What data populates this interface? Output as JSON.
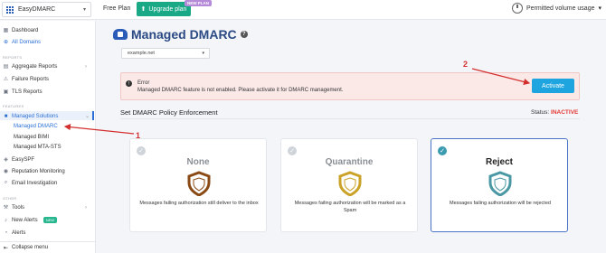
{
  "topbar": {
    "org_name": "EasyDMARC",
    "plan": "Free Plan",
    "upgrade_label": "Upgrade plan",
    "new_plan_badge": "NEW PLAN",
    "usage_label": "Permitted volume usage"
  },
  "sidebar": {
    "top_items": [
      {
        "label": "Dashboard",
        "icon": "dashboard-icon"
      },
      {
        "label": "All Domains",
        "icon": "globe-icon"
      }
    ],
    "reports_section": "REPORTS",
    "report_items": [
      {
        "label": "Aggregate Reports",
        "icon": "chart-icon"
      },
      {
        "label": "Failure Reports",
        "icon": "warning-icon"
      },
      {
        "label": "TLS Reports",
        "icon": "lock-icon"
      }
    ],
    "features_section": "FEATURES",
    "managed_solutions": "Managed Solutions",
    "sub_items": [
      {
        "label": "Managed DMARC"
      },
      {
        "label": "Managed BIMI"
      },
      {
        "label": "Managed MTA-STS"
      }
    ],
    "feature_items": [
      {
        "label": "EasySPF",
        "icon": "spf-icon"
      },
      {
        "label": "Reputation Monitoring",
        "icon": "monitor-icon"
      },
      {
        "label": "Email Investigation",
        "icon": "search-icon"
      }
    ],
    "other_section": "OTHER",
    "other_items": [
      {
        "label": "Tools",
        "icon": "tools-icon"
      },
      {
        "label": "New Alerts",
        "icon": "bell-icon",
        "badge": "NEW"
      },
      {
        "label": "Alerts",
        "icon": "alert-icon"
      }
    ],
    "collapse_label": "Collapse menu"
  },
  "main": {
    "title": "Managed DMARC",
    "domain": "example.net",
    "error_title": "Error",
    "error_message": "Managed DMARC feature is not enabled. Please activate it for DMARC management.",
    "activate_label": "Activate",
    "policy_heading": "Set DMARC Policy Enforcement",
    "status_label": "Status:",
    "status_value": "INACTIVE",
    "cards": [
      {
        "name": "None",
        "desc": "Messages failing authorization still deliver to the inbox",
        "color": "#8a4a16"
      },
      {
        "name": "Quarantine",
        "desc": "Messages failing authorization will be marked as a Spam",
        "color": "#c9a227"
      },
      {
        "name": "Reject",
        "desc": "Messages failing authorization will be rejected",
        "color": "#4a98a4"
      }
    ]
  },
  "annotations": {
    "num1": "1",
    "num2": "2"
  }
}
